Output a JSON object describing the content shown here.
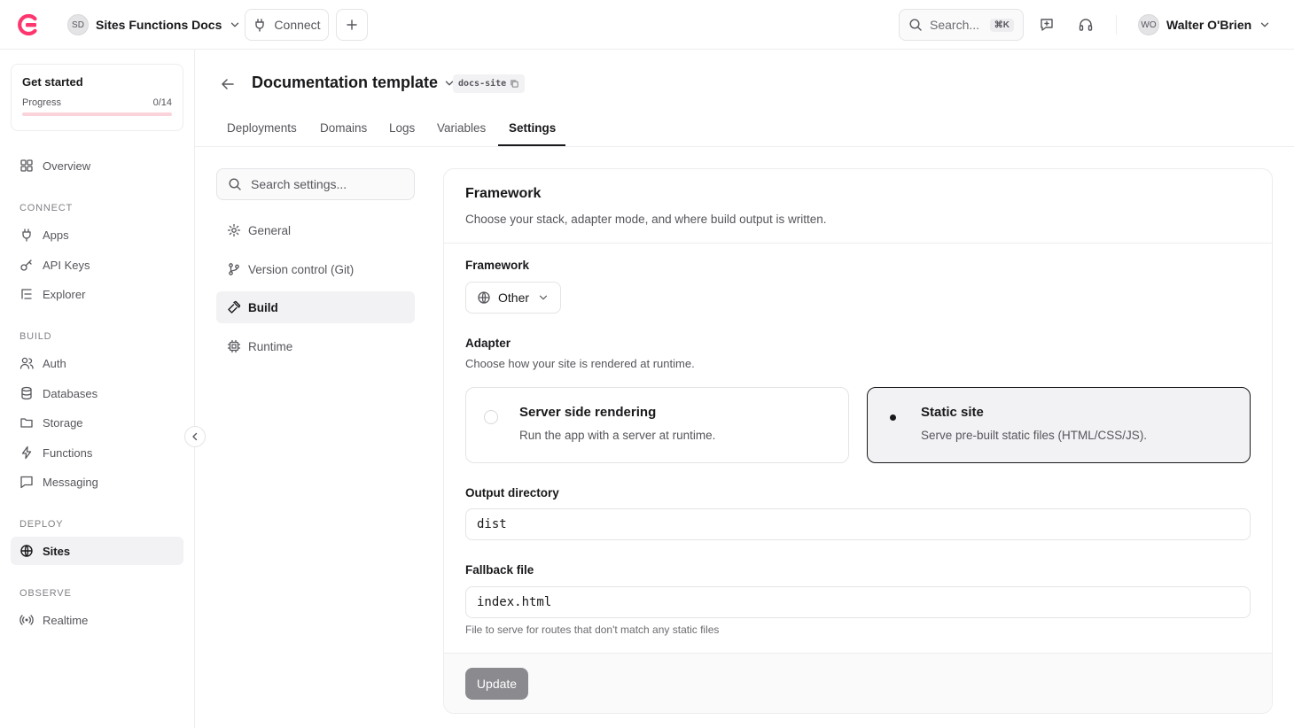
{
  "topbar": {
    "project_initials": "SD",
    "project_name": "Sites Functions Docs",
    "connect_label": "Connect",
    "search_placeholder": "Search...",
    "search_shortcut": "⌘K",
    "user_initials": "WO",
    "user_name": "Walter O'Brien"
  },
  "sidebar": {
    "get_started": {
      "title": "Get started",
      "progress_label": "Progress",
      "progress_value": "0/14",
      "progress_fraction": 0
    },
    "overview": "Overview",
    "sections": {
      "connect": "CONNECT",
      "build": "BUILD",
      "deploy": "DEPLOY",
      "observe": "OBSERVE"
    },
    "items": {
      "apps": "Apps",
      "api_keys": "API Keys",
      "explorer": "Explorer",
      "auth": "Auth",
      "databases": "Databases",
      "storage": "Storage",
      "functions": "Functions",
      "messaging": "Messaging",
      "sites": "Sites",
      "realtime": "Realtime"
    }
  },
  "header": {
    "title": "Documentation template",
    "slug": "docs-site",
    "tabs": [
      "Deployments",
      "Domains",
      "Logs",
      "Variables",
      "Settings"
    ],
    "active_tab": "Settings"
  },
  "settings_nav": {
    "search_placeholder": "Search settings...",
    "items": [
      "General",
      "Version control (Git)",
      "Build",
      "Runtime"
    ],
    "active": "Build"
  },
  "framework_card": {
    "title": "Framework",
    "description": "Choose your stack, adapter mode, and where build output is written.",
    "framework_label": "Framework",
    "framework_value": "Other",
    "adapter_label": "Adapter",
    "adapter_description": "Choose how your site is rendered at runtime.",
    "adapter_options": [
      {
        "title": "Server side rendering",
        "description": "Run the app with a server at runtime.",
        "selected": false
      },
      {
        "title": "Static site",
        "description": "Serve pre-built static files (HTML/CSS/JS).",
        "selected": true
      }
    ],
    "output_label": "Output directory",
    "output_value": "dist",
    "fallback_label": "Fallback file",
    "fallback_value": "index.html",
    "fallback_hint": "File to serve for routes that don't match any static files",
    "update_label": "Update"
  },
  "colors": {
    "accent": "#fd366e",
    "text": "#19191c",
    "muted": "#56565c",
    "border": "#ededf0",
    "disabled_button": "#8a8a8f"
  }
}
